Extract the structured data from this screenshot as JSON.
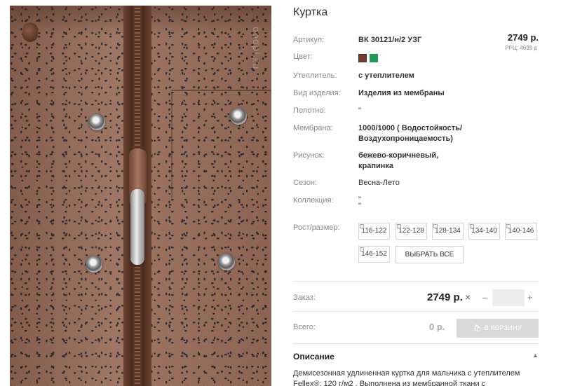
{
  "product": {
    "title": "Куртка",
    "price": "2749 р.",
    "rrp": "РРЦ: 4699 р.",
    "watermark": "ooopi.ru"
  },
  "specs": {
    "article_label": "Артикул:",
    "article_value": "ВК 30121/н/2 УЗГ",
    "color_label": "Цвет:",
    "colors": [
      "#7a3d2d",
      "#1f9a55"
    ],
    "insulation_label": "Утеплитель:",
    "insulation_value": "с утеплителем",
    "type_label": "Вид изделия:",
    "type_value": "Изделия из мембраны",
    "fabric_label": "Полотно:",
    "fabric_value": "\"",
    "membrane_label": "Мембрана:",
    "membrane_value_line1": "1000/1000 ( Водостойкость/",
    "membrane_value_line2": "Воздухопроницаемость)",
    "pattern_label": "Рисунок:",
    "pattern_value_line1": "бежево-коричневый,",
    "pattern_value_line2": "крапинка",
    "season_label": "Сезон:",
    "season_value": "Весна-Лето",
    "collection_label": "Коллекция:",
    "collection_value_line1": "\"",
    "collection_value_line2": "\""
  },
  "sizes": {
    "label": "Рост/размер:",
    "items": [
      "116-122",
      "122-128",
      "128-134",
      "134-140",
      "140-146",
      "146-152"
    ],
    "select_all": "ВЫБРАТЬ ВСЕ"
  },
  "order": {
    "label": "Заказ:",
    "price": "2749 р.",
    "times": "×",
    "minus": "–",
    "plus": "+",
    "quantity": ""
  },
  "total": {
    "label": "Всего:",
    "value": "0 р.",
    "cart_button": "В КОРЗИНУ"
  },
  "description": {
    "heading": "Описание",
    "toggle": "▲",
    "text": "Демисезонная удлиненная куртка для мальчика с утеплителем Fellex®: 120 г/м2 . Выполнена из мембранной ткани с дополнительной"
  }
}
